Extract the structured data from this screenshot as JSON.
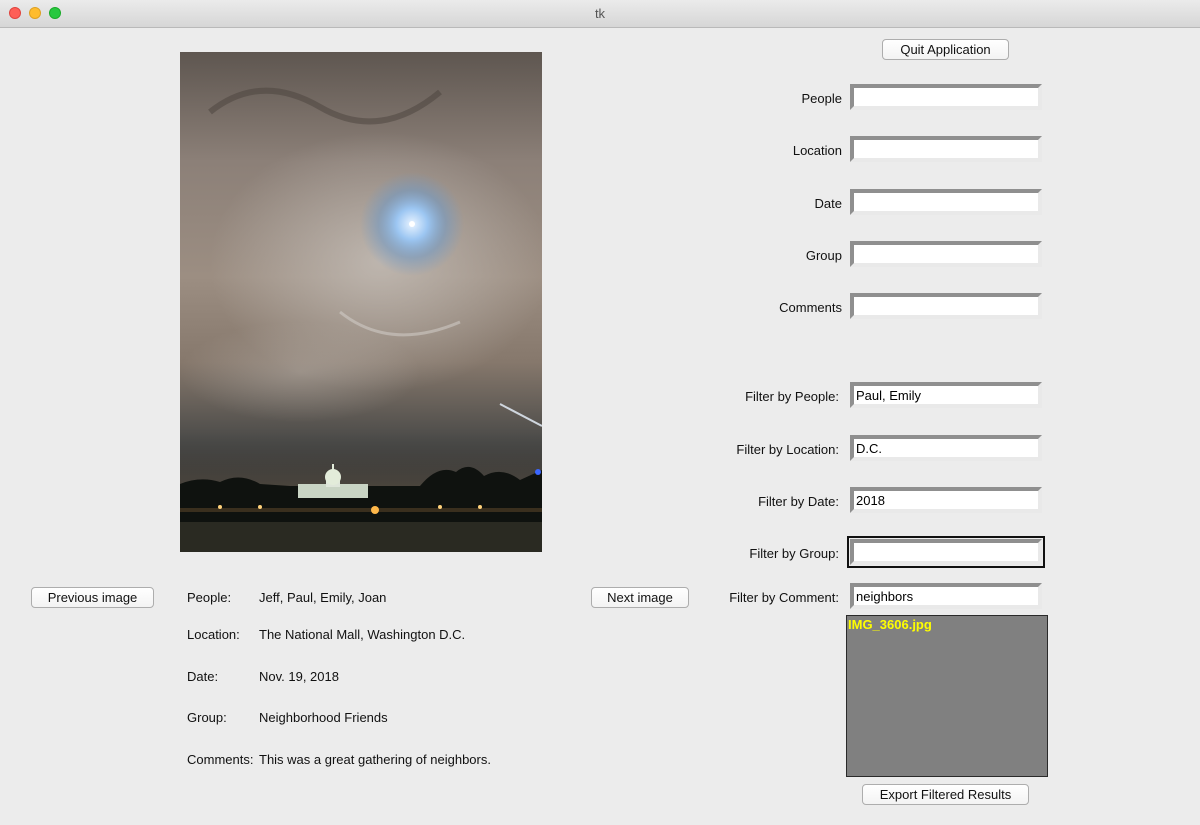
{
  "window": {
    "title": "tk"
  },
  "photo": {},
  "buttons": {
    "quit": "Quit Application",
    "previous": "Previous image",
    "next": "Next image",
    "export": "Export Filtered Results"
  },
  "fields": [
    {
      "label": "People",
      "value": ""
    },
    {
      "label": "Location",
      "value": ""
    },
    {
      "label": "Date",
      "value": ""
    },
    {
      "label": "Group",
      "value": ""
    },
    {
      "label": "Comments",
      "value": ""
    }
  ],
  "filters": [
    {
      "label": "Filter by People:",
      "value": "Paul, Emily"
    },
    {
      "label": "Filter by Location:",
      "value": "D.C."
    },
    {
      "label": "Filter by Date:",
      "value": "2018"
    },
    {
      "label": "Filter by Group:",
      "value": ""
    },
    {
      "label": "Filter by Comment:",
      "value": "neighbors"
    }
  ],
  "info": [
    {
      "label": "People:",
      "value": "Jeff, Paul, Emily, Joan"
    },
    {
      "label": "Location:",
      "value": "The National Mall, Washington D.C."
    },
    {
      "label": "Date:",
      "value": "Nov. 19, 2018"
    },
    {
      "label": "Group:",
      "value": "Neighborhood Friends"
    },
    {
      "label": "Comments:",
      "value": "This was a great gathering of neighbors."
    }
  ],
  "results": {
    "items": [
      "IMG_3606.jpg"
    ]
  },
  "colors": {
    "window_bg": "#ececec",
    "listbox_bg": "#808080",
    "listbox_text": "#ffff00"
  }
}
